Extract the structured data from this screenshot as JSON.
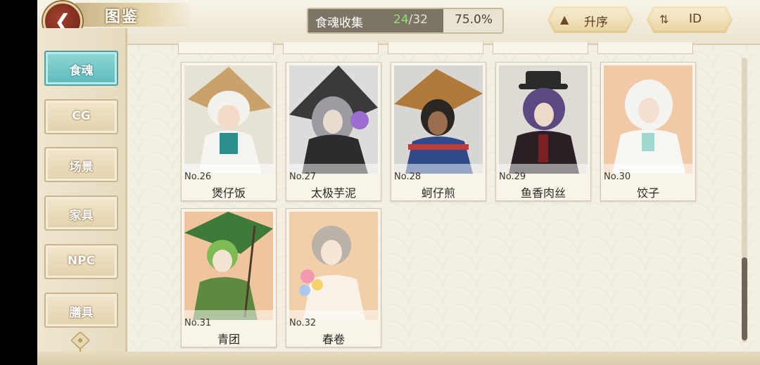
{
  "header": {
    "title": "图鉴",
    "collect_label": "食魂收集",
    "collected": "24",
    "total": "/32",
    "percent": "75.0%",
    "sort_label": "升序",
    "sort_id_label": "ID"
  },
  "sidebar": {
    "items": [
      {
        "label": "食魂",
        "active": true
      },
      {
        "label": "CG",
        "active": false
      },
      {
        "label": "场景",
        "active": false
      },
      {
        "label": "家具",
        "active": false
      },
      {
        "label": "NPC",
        "active": false
      },
      {
        "label": "膳具",
        "active": false
      }
    ]
  },
  "cards": [
    {
      "no": "No.26",
      "name": "煲仔饭"
    },
    {
      "no": "No.27",
      "name": "太极芋泥"
    },
    {
      "no": "No.28",
      "name": "蚵仔煎"
    },
    {
      "no": "No.29",
      "name": "鱼香肉丝"
    },
    {
      "no": "No.30",
      "name": "饺子"
    },
    {
      "no": "No.31",
      "name": "青团"
    },
    {
      "no": "No.32",
      "name": "春卷"
    }
  ],
  "colors": {
    "accent_active": "#5fb9bb",
    "collected_green": "#8fe07a",
    "back_button": "#8a3322"
  }
}
